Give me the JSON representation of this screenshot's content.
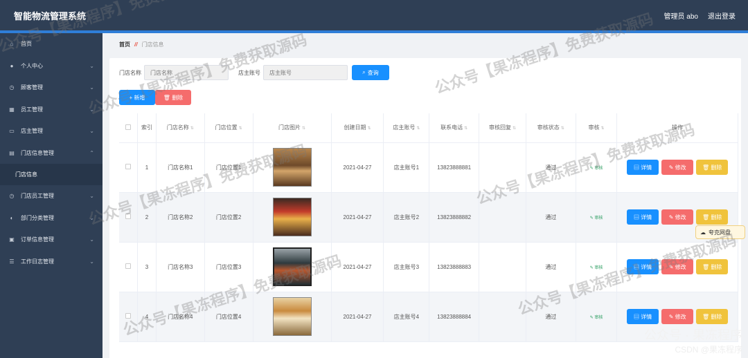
{
  "header": {
    "title": "智能物流管理系统",
    "user": "管理员 abo",
    "logout": "退出登录"
  },
  "sidebar": {
    "items": [
      {
        "label": "首页",
        "icon": "home-icon",
        "chevron": false
      },
      {
        "label": "个人中心",
        "icon": "user-icon",
        "chevron": true
      },
      {
        "label": "顾客管理",
        "icon": "clock-icon",
        "chevron": true
      },
      {
        "label": "员工管理",
        "icon": "grid-icon",
        "chevron": true
      },
      {
        "label": "店主管理",
        "icon": "card-icon",
        "chevron": true
      },
      {
        "label": "门店信息管理",
        "icon": "doc-icon",
        "chevron": true,
        "expanded": true
      }
    ],
    "sub_item": "门店信息",
    "items2": [
      {
        "label": "门店员工管理",
        "icon": "clock-icon",
        "chevron": true
      },
      {
        "label": "部门分类管理",
        "icon": "bulb-icon",
        "chevron": true
      },
      {
        "label": "订单信息管理",
        "icon": "order-icon",
        "chevron": true
      },
      {
        "label": "工作日志管理",
        "icon": "sliders-icon",
        "chevron": true
      }
    ]
  },
  "breadcrumb": {
    "home": "首页",
    "current": "门店信息"
  },
  "search": {
    "store_name_label": "门店名称",
    "store_name_placeholder": "门店名称",
    "owner_label": "店主账号",
    "owner_placeholder": "店主账号",
    "search_button": "查询"
  },
  "actions": {
    "add": "新增",
    "delete": "删除"
  },
  "table": {
    "headers": [
      "索引",
      "门店名称",
      "门店位置",
      "门店图片",
      "创建日期",
      "店主账号",
      "联系电话",
      "审核回复",
      "审核状态",
      "审核",
      "操作"
    ],
    "rows": [
      {
        "index": "1",
        "name": "门店名称1",
        "location": "门店位置1",
        "date": "2021-04-27",
        "owner": "店主账号1",
        "phone": "13823888881",
        "reply": "",
        "status": "通过",
        "audit": "审核"
      },
      {
        "index": "2",
        "name": "门店名称2",
        "location": "门店位置2",
        "date": "2021-04-27",
        "owner": "店主账号2",
        "phone": "13823888882",
        "reply": "",
        "status": "通过",
        "audit": "审核"
      },
      {
        "index": "3",
        "name": "门店名称3",
        "location": "门店位置3",
        "date": "2021-04-27",
        "owner": "店主账号3",
        "phone": "13823888883",
        "reply": "",
        "status": "通过",
        "audit": "审核"
      },
      {
        "index": "4",
        "name": "门店名称4",
        "location": "门店位置4",
        "date": "2021-04-27",
        "owner": "店主账号4",
        "phone": "13823888884",
        "reply": "",
        "status": "通过",
        "audit": "审核"
      }
    ],
    "op_labels": {
      "detail": "详情",
      "edit": "修改",
      "delete": "删除"
    }
  },
  "cloud_badge": "夸克网盘",
  "watermark": "公众号【果冻程序】免费获取源码",
  "corner": {
    "line1": "公众号 · 果冻程序",
    "line2": "CSDN @果冻程序"
  }
}
